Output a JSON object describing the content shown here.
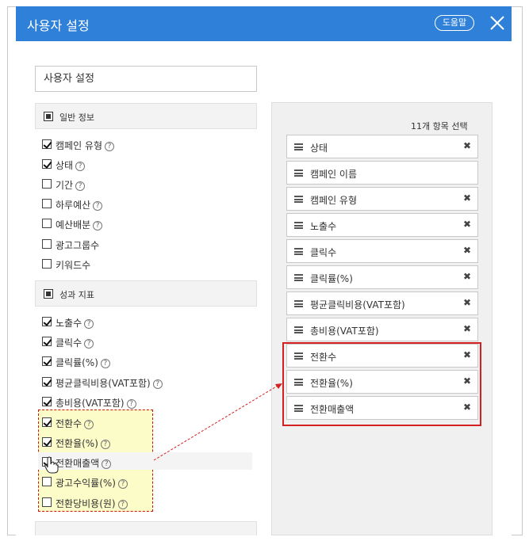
{
  "dialog": {
    "title": "사용자 설정",
    "help_label": "도움말"
  },
  "name_input": {
    "value": "사용자 설정"
  },
  "groups": [
    {
      "label": "일반 정보"
    },
    {
      "label": "성과 지표"
    }
  ],
  "general_items": [
    {
      "label": "캠페인 유형",
      "checked": true,
      "help": true
    },
    {
      "label": "상태",
      "checked": true,
      "help": true
    },
    {
      "label": "기간",
      "checked": false,
      "help": true
    },
    {
      "label": "하루예산",
      "checked": false,
      "help": true
    },
    {
      "label": "예산배분",
      "checked": false,
      "help": true
    },
    {
      "label": "광고그룹수",
      "checked": false,
      "help": false
    },
    {
      "label": "키워드수",
      "checked": false,
      "help": false
    }
  ],
  "performance_items": [
    {
      "label": "노출수",
      "checked": true,
      "help": true
    },
    {
      "label": "클릭수",
      "checked": true,
      "help": true
    },
    {
      "label": "클릭률(%)",
      "checked": true,
      "help": true
    },
    {
      "label": "평균클릭비용(VAT포함)",
      "checked": true,
      "help": true
    },
    {
      "label": "총비용(VAT포함)",
      "checked": true,
      "help": true
    },
    {
      "label": "전환수",
      "checked": true,
      "help": true
    },
    {
      "label": "전환율(%)",
      "checked": true,
      "help": true
    },
    {
      "label": "전환매출액",
      "checked": true,
      "help": true
    },
    {
      "label": "광고수익률(%)",
      "checked": false,
      "help": true
    },
    {
      "label": "전환당비용(원)",
      "checked": false,
      "help": true
    }
  ],
  "selected_panel": {
    "count_label": "11개 항목 선택",
    "items": [
      {
        "label": "상태",
        "removable": true
      },
      {
        "label": "캠페인 이름",
        "removable": false
      },
      {
        "label": "캠페인 유형",
        "removable": true
      },
      {
        "label": "노출수",
        "removable": true
      },
      {
        "label": "클릭수",
        "removable": true
      },
      {
        "label": "클릭률(%)",
        "removable": true
      },
      {
        "label": "평균클릭비용(VAT포함)",
        "removable": true
      },
      {
        "label": "총비용(VAT포함)",
        "removable": true
      },
      {
        "label": "전환수",
        "removable": true
      },
      {
        "label": "전환율(%)",
        "removable": true
      },
      {
        "label": "전환매출액",
        "removable": true
      }
    ]
  },
  "icons": {
    "help_glyph": "?",
    "remove_glyph": "✖"
  },
  "colors": {
    "header_bg": "#2f80d8",
    "highlight_bg": "#fcfcc8",
    "annotation_red": "#d42020"
  }
}
